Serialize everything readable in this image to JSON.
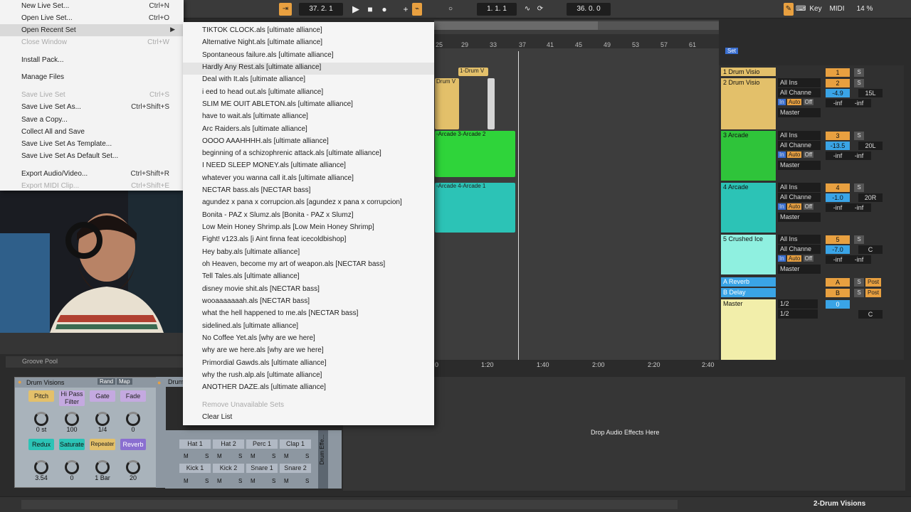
{
  "transport": {
    "position": "37. 2. 1",
    "loop_start": "1. 1. 1",
    "loop_length": "36. 0. 0",
    "key_label": "Key",
    "midi_label": "MIDI",
    "cpu": "14 %"
  },
  "file_menu": {
    "items": [
      {
        "label": "New Live Set...",
        "shortcut": "Ctrl+N",
        "disabled": false
      },
      {
        "label": "Open Live Set...",
        "shortcut": "Ctrl+O",
        "disabled": false
      },
      {
        "label": "Open Recent Set",
        "shortcut": "",
        "disabled": false
      },
      {
        "label": "Close Window",
        "shortcut": "Ctrl+W",
        "disabled": true
      },
      {
        "label": "Install Pack...",
        "shortcut": "",
        "disabled": false
      },
      {
        "label": "Manage Files",
        "shortcut": "",
        "disabled": false
      },
      {
        "label": "Save Live Set",
        "shortcut": "Ctrl+S",
        "disabled": true
      },
      {
        "label": "Save Live Set As...",
        "shortcut": "Ctrl+Shift+S",
        "disabled": false
      },
      {
        "label": "Save a Copy...",
        "shortcut": "",
        "disabled": false
      },
      {
        "label": "Collect All and Save",
        "shortcut": "",
        "disabled": false
      },
      {
        "label": "Save Live Set As Template...",
        "shortcut": "",
        "disabled": false
      },
      {
        "label": "Save Live Set As Default Set...",
        "shortcut": "",
        "disabled": false
      },
      {
        "label": "Export Audio/Video...",
        "shortcut": "Ctrl+Shift+R",
        "disabled": false
      },
      {
        "label": "Export MIDI Clip...",
        "shortcut": "Ctrl+Shift+E",
        "disabled": true
      }
    ]
  },
  "recent_sets": [
    "TIKTOK CLOCK.als [ultimate alliance]",
    "Alternative Night.als [ultimate alliance]",
    "Spontaneous failure.als [ultimate alliance]",
    "Hardly Any Rest.als [ultimate alliance]",
    "Deal with It.als [ultimate alliance]",
    "i eed to head out.als [ultimate alliance]",
    "SLIM ME OUIT ABLETON.als [ultimate alliance]",
    "have to wait.als [ultimate alliance]",
    "Arc Raiders.als [ultimate alliance]",
    "OOOO AAAHHHH.als [ultimate alliance]",
    "beginning of a schizophrenic attack.als [ultimate alliance]",
    "I NEED SLEEP MONEY.als [ultimate alliance]",
    "whatever you wanna call it.als [ultimate alliance]",
    "NECTAR bass.als [NECTAR bass]",
    "agundez x pana x corrupcion.als [agundez x pana x corrupcion]",
    "Bonita - PAZ x Slumz.als [Bonita - PAZ x Slumz]",
    "Low Mein Honey Shrimp.als [Low Mein Honey Shrimp]",
    "Fight! v123.als [i Aint finna feat icecoldbishop]",
    "Hey baby.als [ultimate alliance]",
    "oh Heaven, become my art of weapon.als [NECTAR bass]",
    "Tell Tales.als [ultimate alliance]",
    "disney movie shit.als [NECTAR bass]",
    "wooaaaaaaah.als [NECTAR bass]",
    "what the hell happened to me.als [NECTAR bass]",
    "sidelined.als [ultimate alliance]",
    "No Coffee Yet.als [why are we here]",
    "why are we here.als [why are we here]",
    "Primordial Gawds.als [ultimate alliance]",
    "why the rush.alp.als [ultimate alliance]",
    "ANOTHER DAZE.als [ultimate alliance]"
  ],
  "remove_unavailable": "Remove Unavailable Sets",
  "clear_list": "Clear List",
  "ruler_ticks": [
    "25",
    "29",
    "33",
    "37",
    "41",
    "45",
    "49",
    "53",
    "57",
    "61"
  ],
  "time_ticks": [
    "0",
    "1:20",
    "1:40",
    "2:00",
    "2:20",
    "2:40"
  ],
  "set_label": "Set",
  "clips": {
    "drum1": "1-Drum V",
    "drum2": "Drum V",
    "arcade3": "-Arcade 3-Arcade 2",
    "arcade4": "-Arcade 4-Arcade 1"
  },
  "tracks": [
    {
      "name": "1 Drum Visio",
      "num": "1",
      "color": "#e3c06a"
    },
    {
      "name": "2 Drum Visio",
      "num": "2",
      "color": "#e3c06a",
      "vol": "-4.9",
      "pan": "15L"
    },
    {
      "name": "3 Arcade",
      "num": "3",
      "color": "#2fc43a",
      "vol": "-13.5",
      "pan": "20L"
    },
    {
      "name": "4 Arcade",
      "num": "4",
      "color": "#2cc3b6",
      "vol": "-1.0",
      "pan": "20R"
    },
    {
      "name": "5 Crushed Ice",
      "num": "5",
      "color": "#8ff0e0",
      "vol": "-7.0",
      "pan": "C"
    },
    {
      "name": "A Reverb",
      "num": "A",
      "color": "#3aa4e6"
    },
    {
      "name": "B Delay",
      "num": "B",
      "color": "#3aa4e6"
    },
    {
      "name": "Master",
      "num": "",
      "color": "#f2eeaa"
    }
  ],
  "mixer": {
    "all_ins": "All Ins",
    "all_chan": "All Channe",
    "in": "In",
    "auto": "Auto",
    "off": "Off",
    "inf": "-inf",
    "master": "Master",
    "post": "Post",
    "solo": "S",
    "half": "1/2",
    "zero": "0",
    "c": "C"
  },
  "groove_pool": "Groove Pool",
  "drop_audio_fx": "Drop Audio Effects Here",
  "device": {
    "title": "Drum Visions",
    "rand": "Rand",
    "map": "Map",
    "macros": [
      {
        "label": "Pitch",
        "value": "0 st",
        "color": "#e3c06a"
      },
      {
        "label": "Hi Pass Filter",
        "value": "100",
        "color": "#c4a9e0"
      },
      {
        "label": "Gate",
        "value": "1/4",
        "color": "#c4a9e0"
      },
      {
        "label": "Fade",
        "value": "0",
        "color": "#c4a9e0"
      },
      {
        "label": "Redux",
        "value": "3.54",
        "color": "#2cc3b6"
      },
      {
        "label": "Saturate",
        "value": "0",
        "color": "#2cc3b6"
      },
      {
        "label": "Repeater",
        "value": "1 Bar",
        "color": "#e3c06a"
      },
      {
        "label": "Reverb",
        "value": "20",
        "color": "#8a6fd0"
      }
    ]
  },
  "drum_rack": {
    "title": "Drum",
    "pads": [
      "Hat 1",
      "Hat 2",
      "Perc 1",
      "Clap 1",
      "Kick 1",
      "Kick 2",
      "Snare 1",
      "Snare 2"
    ],
    "m": "M",
    "s": "S",
    "effects": "Drum Effe..."
  },
  "status_bar": {
    "track_name": "2-Drum Visions"
  }
}
